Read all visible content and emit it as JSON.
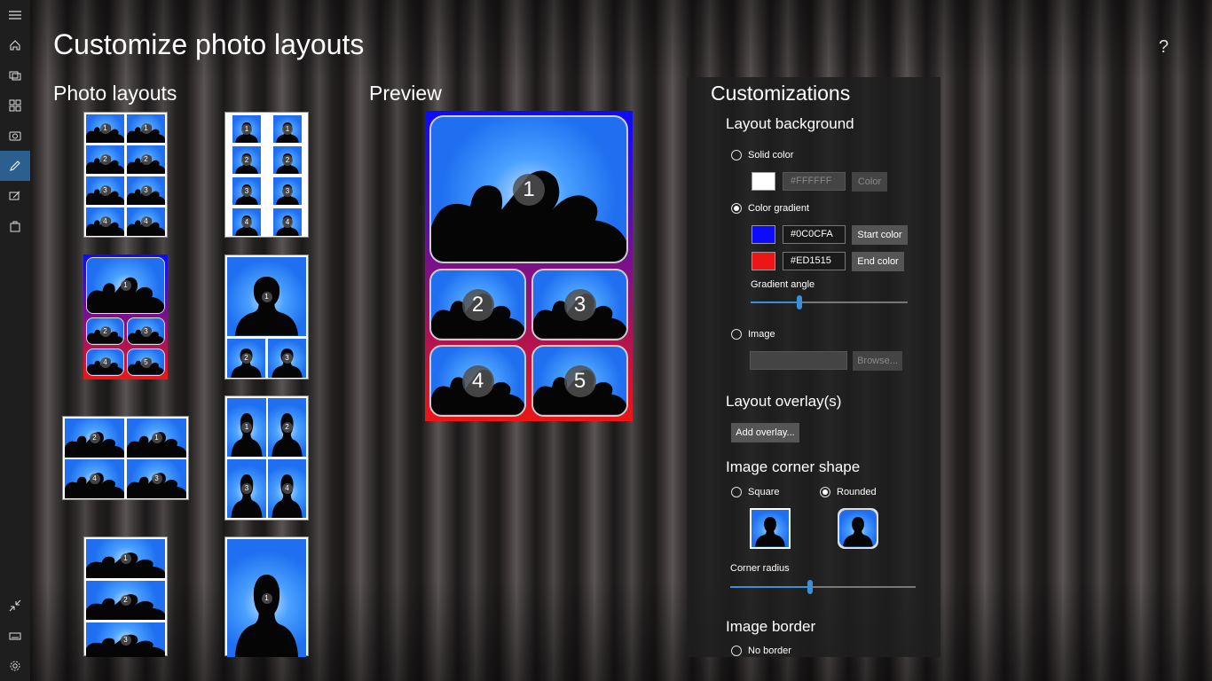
{
  "app": {
    "title": "Customize photo layouts",
    "help": "?"
  },
  "sidebar": {
    "items": [
      {
        "name": "menu-icon"
      },
      {
        "name": "home-icon"
      },
      {
        "name": "slideshow-icon"
      },
      {
        "name": "apps-icon"
      },
      {
        "name": "camera-icon"
      },
      {
        "name": "edit-icon",
        "active": true
      },
      {
        "name": "sign-icon"
      },
      {
        "name": "shop-icon"
      },
      {
        "name": "collapse-icon"
      },
      {
        "name": "keyboard-icon"
      },
      {
        "name": "settings-icon"
      }
    ]
  },
  "layouts": {
    "title": "Photo layouts"
  },
  "preview": {
    "title": "Preview",
    "numbers": [
      "1",
      "2",
      "3",
      "4",
      "5"
    ]
  },
  "customizations": {
    "title": "Customizations",
    "layout_background": {
      "title": "Layout background",
      "solid_color": {
        "label": "Solid color",
        "selected": false,
        "value": "#FFFFFF",
        "button": "Color",
        "swatch": "#FFFFFF"
      },
      "color_gradient": {
        "label": "Color gradient",
        "selected": true,
        "start_value": "#0C0CFA",
        "start_button": "Start color",
        "start_swatch": "#0C0CFA",
        "end_value": "#ED1515",
        "end_button": "End color",
        "end_swatch": "#ED1515",
        "angle_label": "Gradient angle",
        "angle_fraction": 0.31
      },
      "image": {
        "label": "Image",
        "selected": false,
        "button": "Browse..."
      }
    },
    "overlays": {
      "title": "Layout overlay(s)",
      "button": "Add overlay..."
    },
    "corner_shape": {
      "title": "Image corner shape",
      "square_label": "Square",
      "rounded_label": "Rounded",
      "selected": "Rounded",
      "radius_label": "Corner radius",
      "radius_fraction": 0.43
    },
    "border": {
      "title": "Image border",
      "no_border_label": "No border"
    }
  },
  "colors": {
    "accent": "#3A8FD8",
    "gradient_start": "#0C0CFA",
    "gradient_end": "#ED1515"
  }
}
